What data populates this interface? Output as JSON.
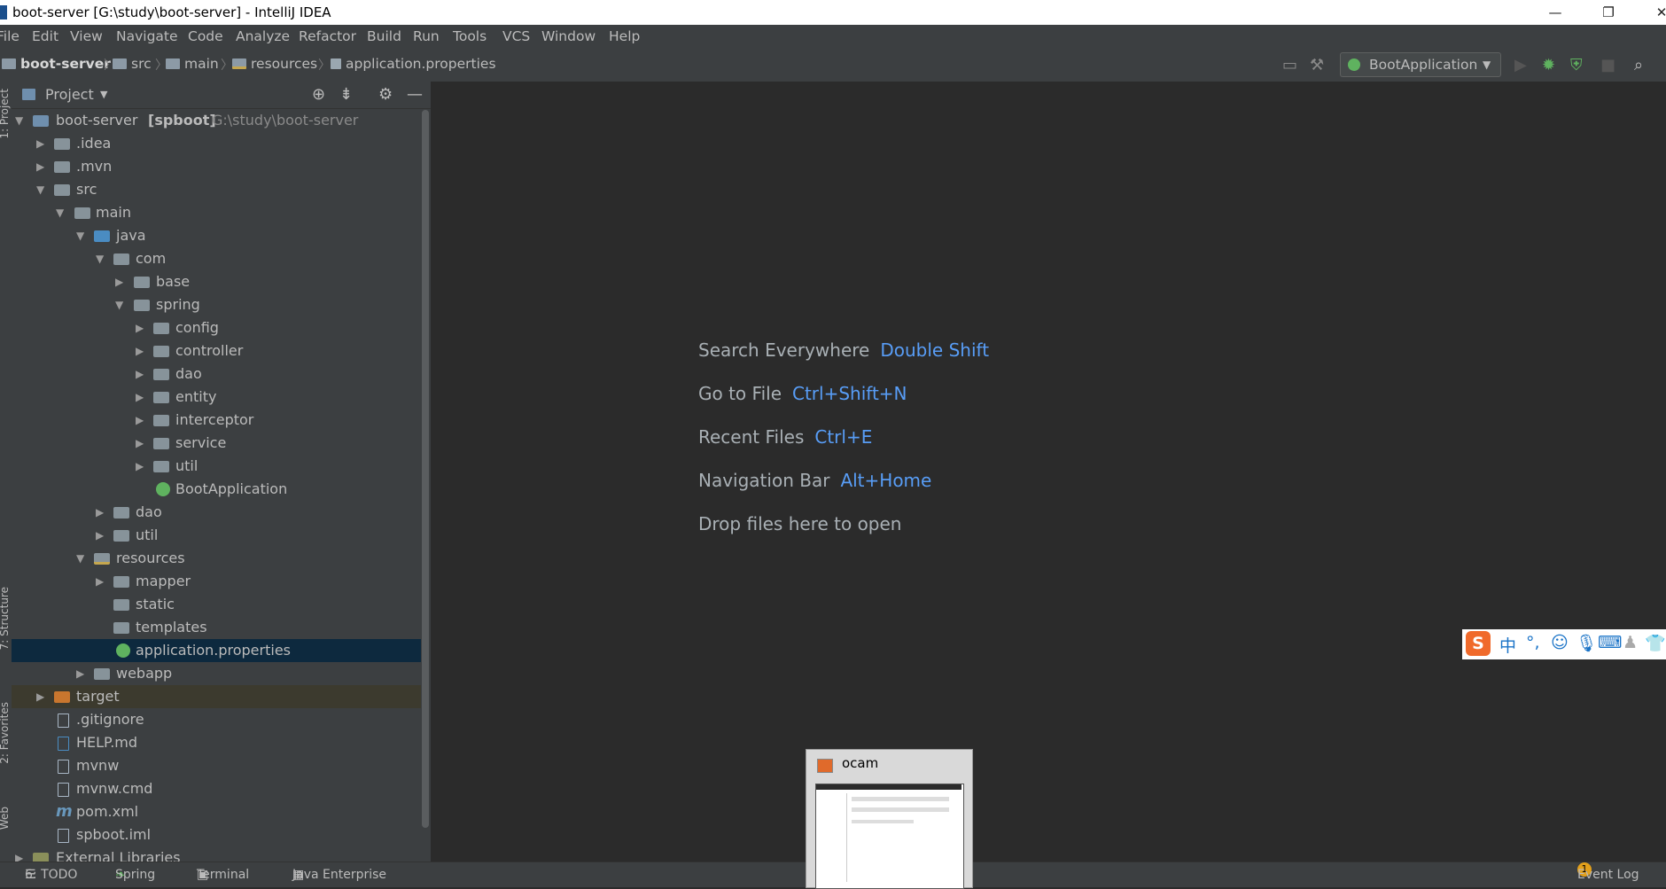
{
  "window": {
    "title": "boot-server [G:\\study\\boot-server] - IntelliJ IDEA",
    "minimize": "—",
    "restore": "❐",
    "close": "✕"
  },
  "menu": [
    "File",
    "Edit",
    "View",
    "Navigate",
    "Code",
    "Analyze",
    "Refactor",
    "Build",
    "Run",
    "Tools",
    "VCS",
    "Window",
    "Help"
  ],
  "breadcrumb": [
    "boot-server",
    "src",
    "main",
    "resources",
    "application.properties"
  ],
  "run_config": "BootApplication",
  "project_panel": {
    "title": "Project",
    "tree": [
      {
        "label": "boot-server",
        "bold": "[spboot]",
        "path": "G:\\study\\boot-server",
        "icon": "module-icon"
      },
      {
        "label": ".idea",
        "icon": "folder-icon"
      },
      {
        "label": ".mvn",
        "icon": "folder-icon"
      },
      {
        "label": "src",
        "icon": "folder-icon"
      },
      {
        "label": "main",
        "icon": "folder-icon"
      },
      {
        "label": "java",
        "icon": "source-folder-icon"
      },
      {
        "label": "com",
        "icon": "package-icon"
      },
      {
        "label": "base",
        "icon": "package-icon"
      },
      {
        "label": "spring",
        "icon": "package-icon"
      },
      {
        "label": "config",
        "icon": "package-icon"
      },
      {
        "label": "controller",
        "icon": "package-icon"
      },
      {
        "label": "dao",
        "icon": "package-icon"
      },
      {
        "label": "entity",
        "icon": "package-icon"
      },
      {
        "label": "interceptor",
        "icon": "package-icon"
      },
      {
        "label": "service",
        "icon": "package-icon"
      },
      {
        "label": "util",
        "icon": "package-icon"
      },
      {
        "label": "BootApplication",
        "icon": "spring-boot-class-icon"
      },
      {
        "label": "dao",
        "icon": "package-icon"
      },
      {
        "label": "util",
        "icon": "package-icon"
      },
      {
        "label": "resources",
        "icon": "resources-folder-icon"
      },
      {
        "label": "mapper",
        "icon": "package-icon"
      },
      {
        "label": "static",
        "icon": "folder-icon"
      },
      {
        "label": "templates",
        "icon": "folder-icon"
      },
      {
        "label": "application.properties",
        "icon": "spring-properties-icon"
      },
      {
        "label": "webapp",
        "icon": "folder-icon"
      },
      {
        "label": "target",
        "icon": "excluded-folder-icon"
      },
      {
        "label": ".gitignore",
        "icon": "file-icon"
      },
      {
        "label": "HELP.md",
        "icon": "markdown-file-icon"
      },
      {
        "label": "mvnw",
        "icon": "file-icon"
      },
      {
        "label": "mvnw.cmd",
        "icon": "file-icon"
      },
      {
        "label": "pom.xml",
        "icon": "maven-icon"
      },
      {
        "label": "spboot.iml",
        "icon": "file-icon"
      },
      {
        "label": "External Libraries",
        "icon": "library-icon"
      }
    ]
  },
  "side_tabs": {
    "project": "1: Project",
    "structure": "7: Structure",
    "favorites": "2: Favorites",
    "web": "Web"
  },
  "editor_hints": [
    {
      "text": "Search Everywhere",
      "key": "Double Shift"
    },
    {
      "text": "Go to File",
      "key": "Ctrl+Shift+N"
    },
    {
      "text": "Recent Files",
      "key": "Ctrl+E"
    },
    {
      "text": "Navigation Bar",
      "key": "Alt+Home"
    },
    {
      "text": "Drop files here to open",
      "key": ""
    }
  ],
  "status_tabs": [
    "6: TODO",
    "Spring",
    "Terminal",
    "Java Enterprise"
  ],
  "event_log": {
    "label": "Event Log",
    "count": "1"
  },
  "ocam_popup": {
    "title": "ocam"
  },
  "ime_toolbar": {
    "logo": "S",
    "mode": "中",
    "punct": "°,"
  }
}
